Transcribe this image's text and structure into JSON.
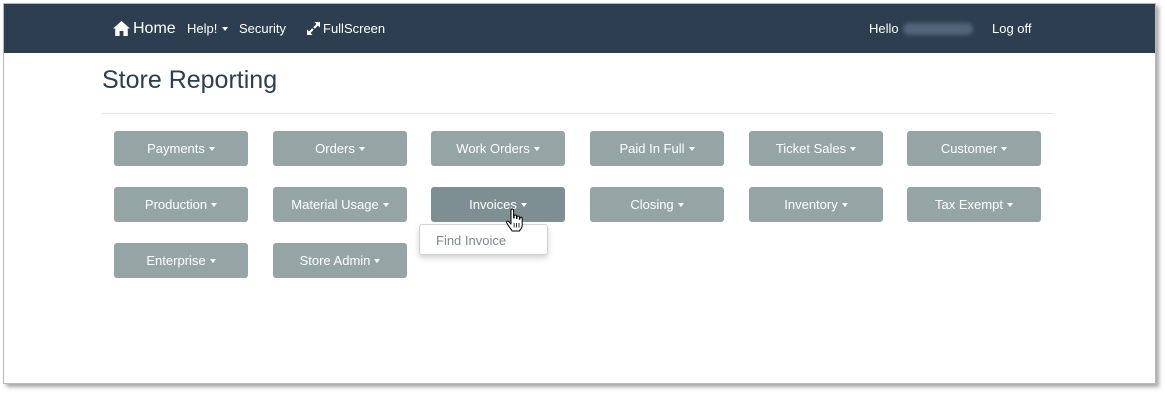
{
  "navbar": {
    "home_label": "Home",
    "help_label": "Help!",
    "security_label": "Security",
    "fullscreen_label": "FullScreen",
    "hello_label": "Hello",
    "logoff_label": "Log off",
    "home_icon": "home-icon",
    "fullscreen_icon": "expand-icon"
  },
  "page": {
    "title": "Store Reporting"
  },
  "menu": {
    "buttons": [
      {
        "label": "Payments"
      },
      {
        "label": "Orders"
      },
      {
        "label": "Work Orders"
      },
      {
        "label": "Paid In Full"
      },
      {
        "label": "Ticket Sales"
      },
      {
        "label": "Customer"
      },
      {
        "label": "Production"
      },
      {
        "label": "Material Usage"
      },
      {
        "label": "Invoices"
      },
      {
        "label": "Closing"
      },
      {
        "label": "Inventory"
      },
      {
        "label": "Tax Exempt"
      },
      {
        "label": "Enterprise"
      },
      {
        "label": "Store Admin"
      }
    ],
    "open_dropdown": {
      "parent": "Invoices",
      "items": [
        {
          "label": "Find Invoice"
        }
      ]
    }
  },
  "colors": {
    "navbar_bg": "#2c3e50",
    "button_bg": "#95a5a6",
    "button_active_bg": "#7e8f93",
    "title_color": "#2c3e50"
  }
}
